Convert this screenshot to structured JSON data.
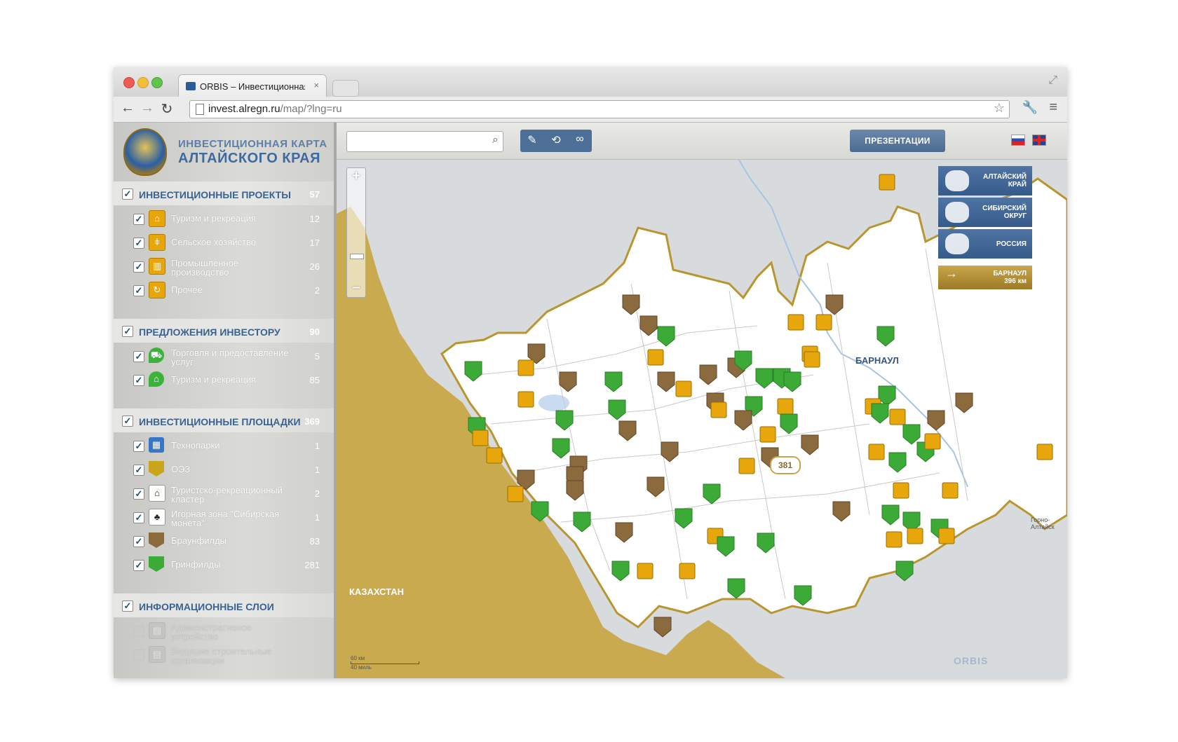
{
  "browser": {
    "tab_title": "ORBIS – Инвестиционная",
    "tab_close": "×",
    "url_host": "invest.alregn.ru",
    "url_path": "/map/?lng=ru"
  },
  "sidebar": {
    "title_line1": "ИНВЕСТИЦИОННАЯ КАРТА",
    "title_line2": "АЛТАЙСКОГО КРАЯ",
    "sections": [
      {
        "label": "ИНВЕСТИЦИОННЫЕ ПРОЕКТЫ",
        "count": "57",
        "items": [
          {
            "label": "Туризм и рекреация",
            "count": "12"
          },
          {
            "label": "Сельское хозяйство",
            "count": "17"
          },
          {
            "label": "Промышленное производство",
            "count": "26"
          },
          {
            "label": "Прочее",
            "count": "2"
          }
        ]
      },
      {
        "label": "ПРЕДЛОЖЕНИЯ ИНВЕСТОРУ",
        "count": "90",
        "items": [
          {
            "label": "Торговля и предоставление услуг",
            "count": "5"
          },
          {
            "label": "Туризм и рекреация",
            "count": "85"
          }
        ]
      },
      {
        "label": "ИНВЕСТИЦИОННЫЕ ПЛОЩАДКИ",
        "count": "369",
        "items": [
          {
            "label": "Технопарки",
            "count": "1"
          },
          {
            "label": "ОЭЗ",
            "count": "1"
          },
          {
            "label": "Туристско-рекреационный кластер",
            "count": "2"
          },
          {
            "label": "Игорная зона \"Сибирская монета\"",
            "count": "1"
          },
          {
            "label": "Браунфилды",
            "count": "83"
          },
          {
            "label": "Гринфилды",
            "count": "281"
          }
        ]
      },
      {
        "label": "ИНФОРМАЦИОННЫЕ СЛОИ",
        "items": [
          {
            "label": "Административное устройство"
          },
          {
            "label": "Ведущие строительные организации"
          }
        ]
      }
    ]
  },
  "map": {
    "search_placeholder": "",
    "presentations_label": "ПРЕЗЕНТАЦИИ",
    "region_buttons": [
      {
        "label": "АЛТАЙСКИЙ КРАЙ"
      },
      {
        "label": "СИБИРСКИЙ ОКРУГ"
      },
      {
        "label": "РОССИЯ"
      }
    ],
    "distance": {
      "city": "БАРНАУЛ",
      "value": "396 км"
    },
    "capital_label": "БАРНАУЛ",
    "country_label": "КАЗАХСТАН",
    "cluster_count": "381",
    "city_label_gorno": "Горно-Алтайск",
    "scale_km": "60 км",
    "scale_mi": "40 миль",
    "brand": "ORBIS",
    "colors": {
      "territory": "#ffffff",
      "border": "#b8952e",
      "kazakhstan": "#c9aa4f",
      "marker_green": "#3caa36",
      "marker_brown": "#8b6a3e",
      "marker_orange": "#e6a60c"
    }
  }
}
